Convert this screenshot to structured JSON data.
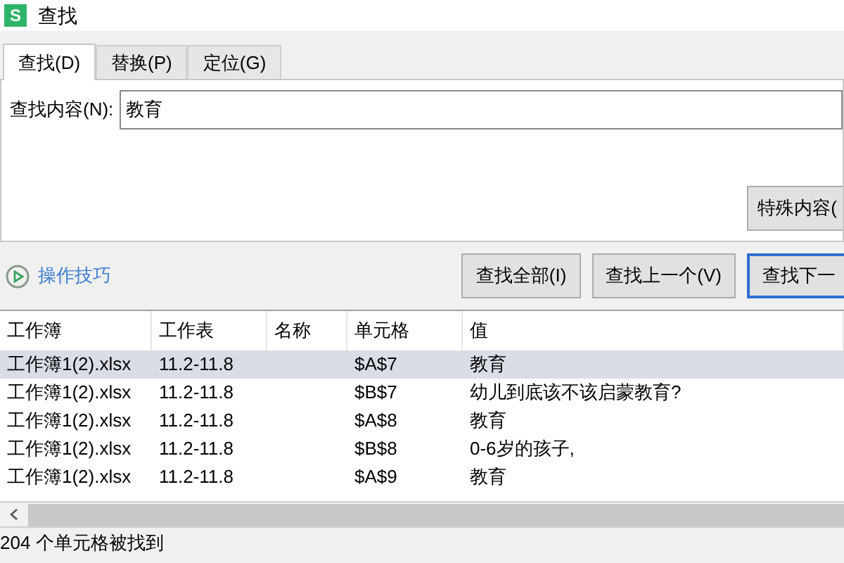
{
  "window": {
    "title": "查找",
    "app_icon": "S"
  },
  "tabs": [
    {
      "label": "查找(D)",
      "selected": true
    },
    {
      "label": "替换(P)",
      "selected": false
    },
    {
      "label": "定位(G)",
      "selected": false
    }
  ],
  "find_field": {
    "label": "查找内容(N):",
    "value": "教育"
  },
  "special_button": "特殊内容(",
  "tips_link": "操作技巧",
  "buttons": [
    {
      "label": "查找全部(I)",
      "default": false
    },
    {
      "label": "查找上一个(V)",
      "default": false
    },
    {
      "label": "查找下一",
      "default": true
    }
  ],
  "table": {
    "columns": [
      "工作簿",
      "工作表",
      "名称",
      "单元格",
      "值"
    ],
    "rows": [
      {
        "cells": [
          "工作簿1(2).xlsx",
          "11.2-11.8",
          "",
          "$A$7",
          "教育"
        ],
        "selected": true
      },
      {
        "cells": [
          "工作簿1(2).xlsx",
          "11.2-11.8",
          "",
          "$B$7",
          "幼儿到底该不该启蒙教育?"
        ],
        "selected": false
      },
      {
        "cells": [
          "工作簿1(2).xlsx",
          "11.2-11.8",
          "",
          "$A$8",
          "教育"
        ],
        "selected": false
      },
      {
        "cells": [
          "工作簿1(2).xlsx",
          "11.2-11.8",
          "",
          "$B$8",
          "0-6岁的孩子,"
        ],
        "selected": false
      },
      {
        "cells": [
          "工作簿1(2).xlsx",
          "11.2-11.8",
          "",
          "$A$9",
          "教育"
        ],
        "selected": false
      }
    ]
  },
  "status_bar": "204 个单元格被找到"
}
